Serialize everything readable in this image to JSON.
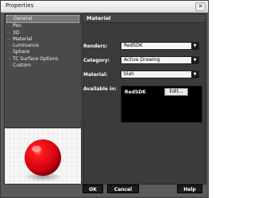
{
  "window": {
    "title": "Properties",
    "close_glyph": "✕"
  },
  "tree": {
    "items": [
      "General",
      "Pen",
      "3D",
      "Material",
      "Luminance",
      "Sphere",
      "TC Surface Options",
      "Custom"
    ],
    "selected": "General"
  },
  "panel": {
    "title": "Material",
    "renders_label": "Renders:",
    "renders_value": "RedSDK",
    "category_label": "Category:",
    "category_value": "Active Drawing",
    "material_label": "Material:",
    "material_value": "blah",
    "available_label": "Available in:",
    "available_item": "RedSDK",
    "edit_label": "Edit..."
  },
  "buttons": {
    "ok": "OK",
    "cancel": "Cancel",
    "help": "Help"
  },
  "colors": {
    "sphere": "#e8000f",
    "panel_bg": "#3b3b3b",
    "window_bg": "#5a5a5a"
  },
  "icons": {
    "dropdown": "chevron-down-icon",
    "close": "close-icon"
  }
}
